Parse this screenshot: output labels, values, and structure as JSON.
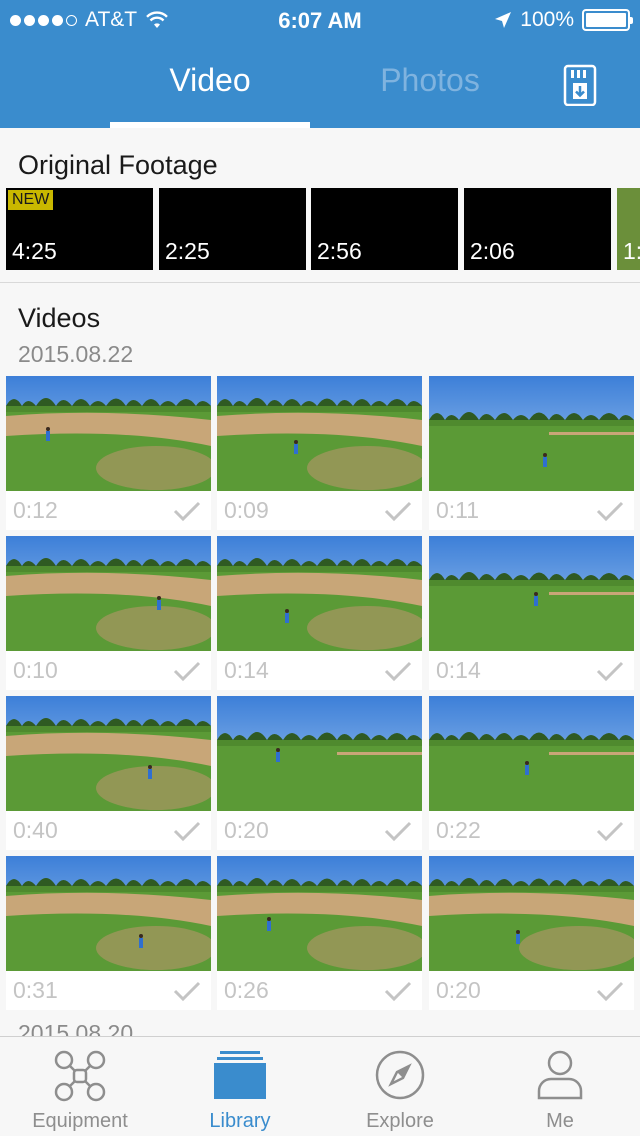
{
  "status_bar": {
    "carrier": "AT&T",
    "time": "6:07 AM",
    "battery": "100%"
  },
  "header": {
    "tabs": [
      {
        "label": "Video",
        "active": true
      },
      {
        "label": "Photos",
        "active": false
      }
    ],
    "download_icon": "sd-card-download-icon"
  },
  "original_footage": {
    "title": "Original Footage",
    "badge": "NEW",
    "items": [
      {
        "duration": "4:25"
      },
      {
        "duration": "2:25"
      },
      {
        "duration": "2:56"
      },
      {
        "duration": "2:06"
      },
      {
        "duration": "1:"
      }
    ]
  },
  "videos": {
    "title": "Videos",
    "date": "2015.08.22",
    "next_date": "2015.08.20",
    "items": [
      {
        "duration": "0:12"
      },
      {
        "duration": "0:09"
      },
      {
        "duration": "0:11"
      },
      {
        "duration": "0:10"
      },
      {
        "duration": "0:14"
      },
      {
        "duration": "0:14"
      },
      {
        "duration": "0:40"
      },
      {
        "duration": "0:20"
      },
      {
        "duration": "0:22"
      },
      {
        "duration": "0:31"
      },
      {
        "duration": "0:26"
      },
      {
        "duration": "0:20"
      }
    ]
  },
  "tab_bar": {
    "items": [
      {
        "label": "Equipment",
        "icon": "drone-icon",
        "active": false
      },
      {
        "label": "Library",
        "icon": "library-icon",
        "active": true
      },
      {
        "label": "Explore",
        "icon": "compass-icon",
        "active": false
      },
      {
        "label": "Me",
        "icon": "person-icon",
        "active": false
      }
    ]
  },
  "colors": {
    "brand_blue": "#3a8ccd",
    "new_badge": "#c9b800"
  }
}
